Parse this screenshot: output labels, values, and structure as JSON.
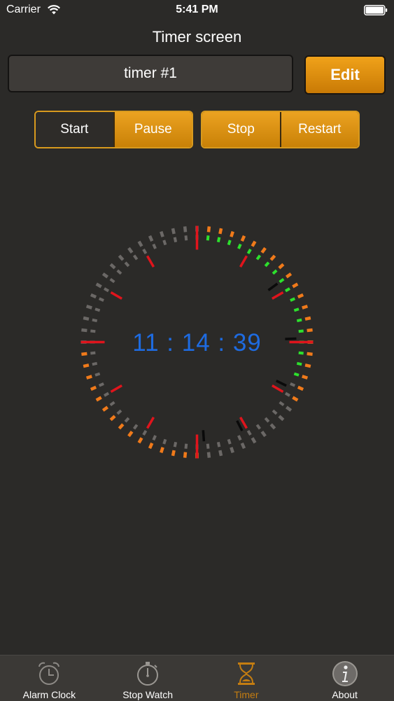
{
  "status_bar": {
    "carrier": "Carrier",
    "time": "5:41 PM"
  },
  "header": {
    "title": "Timer screen"
  },
  "timer": {
    "name": "timer #1",
    "edit_label": "Edit",
    "display": "11 : 14 : 39",
    "hours": 11,
    "minutes": 14,
    "seconds": 39
  },
  "controls": {
    "start_label": "Start",
    "pause_label": "Pause",
    "stop_label": "Stop",
    "restart_label": "Restart"
  },
  "tabs": [
    {
      "label": "Alarm Clock",
      "icon": "alarm-clock-icon",
      "active": false
    },
    {
      "label": "Stop Watch",
      "icon": "stopwatch-icon",
      "active": false
    },
    {
      "label": "Timer",
      "icon": "hourglass-icon",
      "active": true
    },
    {
      "label": "About",
      "icon": "info-icon",
      "active": false
    }
  ],
  "colors": {
    "background": "#2b2a28",
    "accent": "#e39a17",
    "digits": "#1e6be0",
    "hour_marks": "#e0141c",
    "seconds_progress": "#2de02d",
    "minutes_progress": "#f07a1a",
    "inactive_ticks": "#6b6866",
    "hours_ticks": "#0a0a0a"
  }
}
